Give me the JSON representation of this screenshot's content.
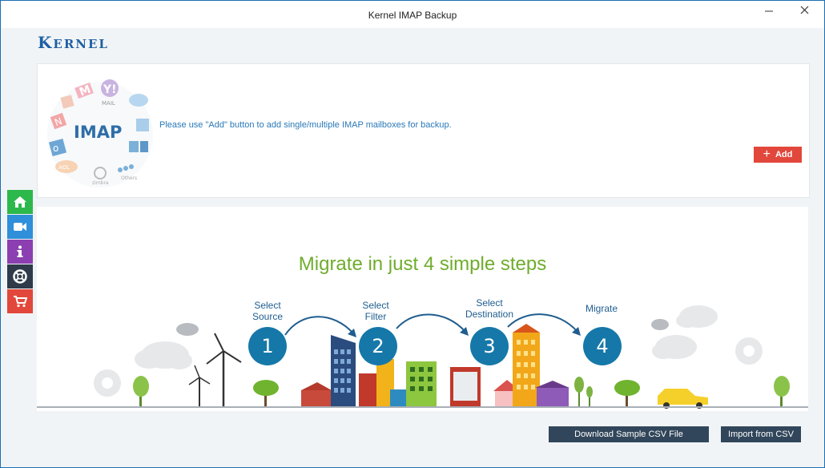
{
  "window": {
    "title": "Kernel IMAP Backup"
  },
  "brand": {
    "logo_first": "K",
    "logo_rest": "ERNEL"
  },
  "imap_panel": {
    "logo_text": "IMAP",
    "icon_labels": {
      "yahoo": "MAIL",
      "zimbra": "zimbra",
      "others": "Others",
      "aol": "AOL"
    },
    "instruction": "Please use \"Add\" button to add single/multiple IMAP mailboxes for backup.",
    "add_label": "Add"
  },
  "sidebar": {
    "items": [
      {
        "icon": "home-icon",
        "color": "#2db84c"
      },
      {
        "icon": "video-icon",
        "color": "#2f8fd8"
      },
      {
        "icon": "info-icon",
        "color": "#8c3fb0"
      },
      {
        "icon": "lifebuoy-icon",
        "color": "#2f3b4a"
      },
      {
        "icon": "cart-icon",
        "color": "#e2473b"
      }
    ]
  },
  "steps_panel": {
    "headline": "Migrate in just 4 simple steps",
    "steps": [
      {
        "number": "1",
        "label_line1": "Select",
        "label_line2": "Source"
      },
      {
        "number": "2",
        "label_line1": "Select",
        "label_line2": "Filter"
      },
      {
        "number": "3",
        "label_line1": "Select",
        "label_line2": "Destination"
      },
      {
        "number": "4",
        "label_line1": "Migrate",
        "label_line2": ""
      }
    ]
  },
  "footer": {
    "download_csv_label": "Download Sample CSV File",
    "import_csv_label": "Import from CSV"
  },
  "colors": {
    "accent_red": "#e2473b",
    "brand_blue": "#1d5fa4",
    "headline_green": "#6fac2c",
    "step_blue": "#1678a8",
    "footer_button": "#31465a"
  }
}
